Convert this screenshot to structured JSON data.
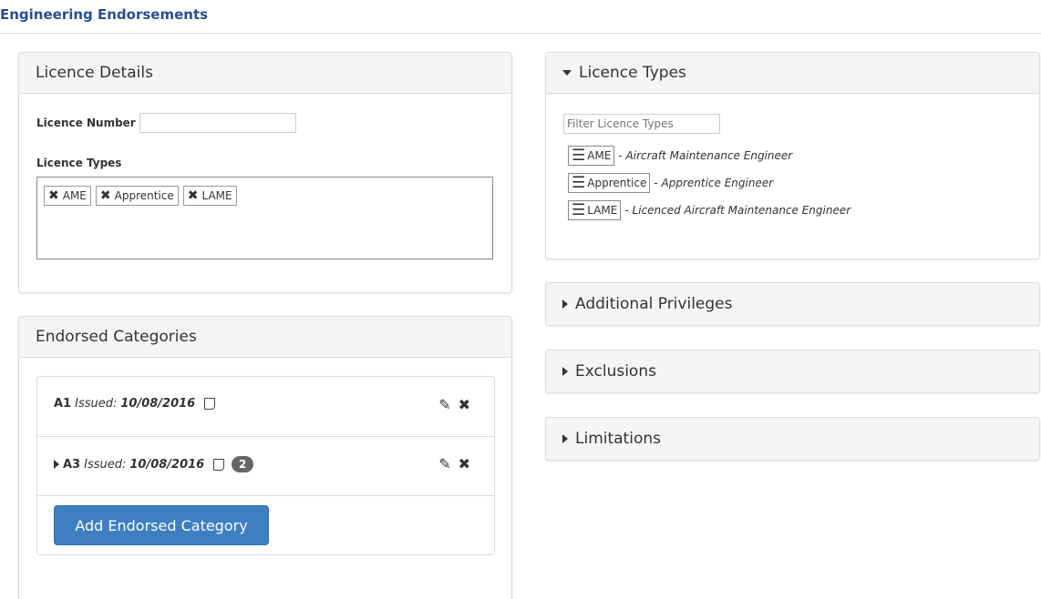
{
  "page": {
    "title": "Engineering Endorsements"
  },
  "licence_details": {
    "heading": "Licence Details",
    "licence_number_label": "Licence Number",
    "licence_number_value": "",
    "licence_types_label": "Licence Types",
    "selected_types": [
      "AME",
      "Apprentice",
      "LAME"
    ]
  },
  "endorsed_categories": {
    "heading": "Endorsed Categories",
    "rows": [
      {
        "code": "A1",
        "issued_label": "Issued:",
        "date": "10/08/2016",
        "count": ""
      },
      {
        "code": "A3",
        "issued_label": "Issued:",
        "date": "10/08/2016",
        "count": "2"
      }
    ],
    "add_button": "Add Endorsed Category"
  },
  "licence_types_panel": {
    "heading": "Licence Types",
    "filter_placeholder": "Filter Licence Types",
    "items": [
      {
        "code": "AME",
        "desc": "- Aircraft Maintenance Engineer"
      },
      {
        "code": "Apprentice",
        "desc": "- Apprentice Engineer"
      },
      {
        "code": "LAME",
        "desc": "- Licenced Aircraft Maintenance Engineer"
      }
    ]
  },
  "collapsed_panels": [
    "Additional Privileges",
    "Exclusions",
    "Limitations"
  ],
  "colors": {
    "title": "#2a4d8f",
    "primary_button": "#3d7fc1",
    "panel_heading_bg": "#f5f5f5"
  },
  "icons": {
    "remove": "x-icon",
    "edit": "pencil-icon",
    "note": "note-icon",
    "drag": "menu-icon"
  }
}
